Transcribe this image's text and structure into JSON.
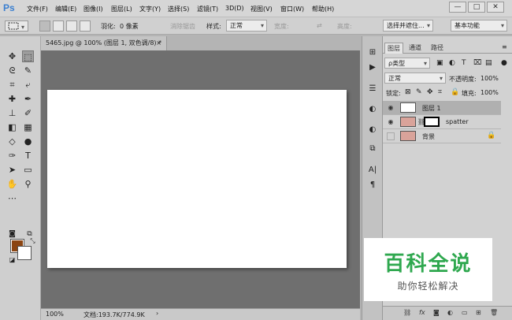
{
  "app_logo": "Ps",
  "menu": [
    "文件(F)",
    "编辑(E)",
    "图像(I)",
    "图层(L)",
    "文字(Y)",
    "选择(S)",
    "滤镜(T)",
    "3D(D)",
    "视图(V)",
    "窗口(W)",
    "帮助(H)"
  ],
  "window_controls": {
    "minimize": "—",
    "restore": "□",
    "close": "✕"
  },
  "options": {
    "feather_label": "羽化:",
    "feather_value": "0 像素",
    "antialias_label": "消除锯齿",
    "style_label": "样式:",
    "style_value": "正常",
    "width_label": "宽度:",
    "height_label": "高度:",
    "select_mask_button": "选择并遮住...",
    "workspace_value": "基本功能"
  },
  "document": {
    "tab_title": "5465.jpg @ 100% (图层 1, 双色调/8) *",
    "tab_close": "×",
    "zoom": "100%",
    "doc_info": "文档:193.7K/774.9K",
    "canvas_color": "#ffffff"
  },
  "colors": {
    "foreground": "#8b4513",
    "background": "#ffffff"
  },
  "layers_panel": {
    "tabs": [
      "图层",
      "通道",
      "路径"
    ],
    "kind_filter": "ρ类型",
    "blend_mode": "正常",
    "opacity_label": "不透明度:",
    "opacity_value": "100%",
    "lock_label": "锁定:",
    "fill_label": "填充:",
    "fill_value": "100%",
    "layers": [
      {
        "name": "图层 1",
        "visible": true,
        "selected": true
      },
      {
        "name": "spatter",
        "visible": true,
        "selected": false
      },
      {
        "name": "背景",
        "visible": false,
        "selected": false,
        "locked": true
      }
    ],
    "bottom_icons": [
      "link-icon",
      "fx-icon",
      "mask-icon",
      "adjustment-icon",
      "group-icon",
      "new-layer-icon",
      "trash-icon"
    ]
  },
  "watermark": {
    "title": "百科全说",
    "subtitle": "助你轻松解决",
    "title_color": "#2fa84f"
  }
}
